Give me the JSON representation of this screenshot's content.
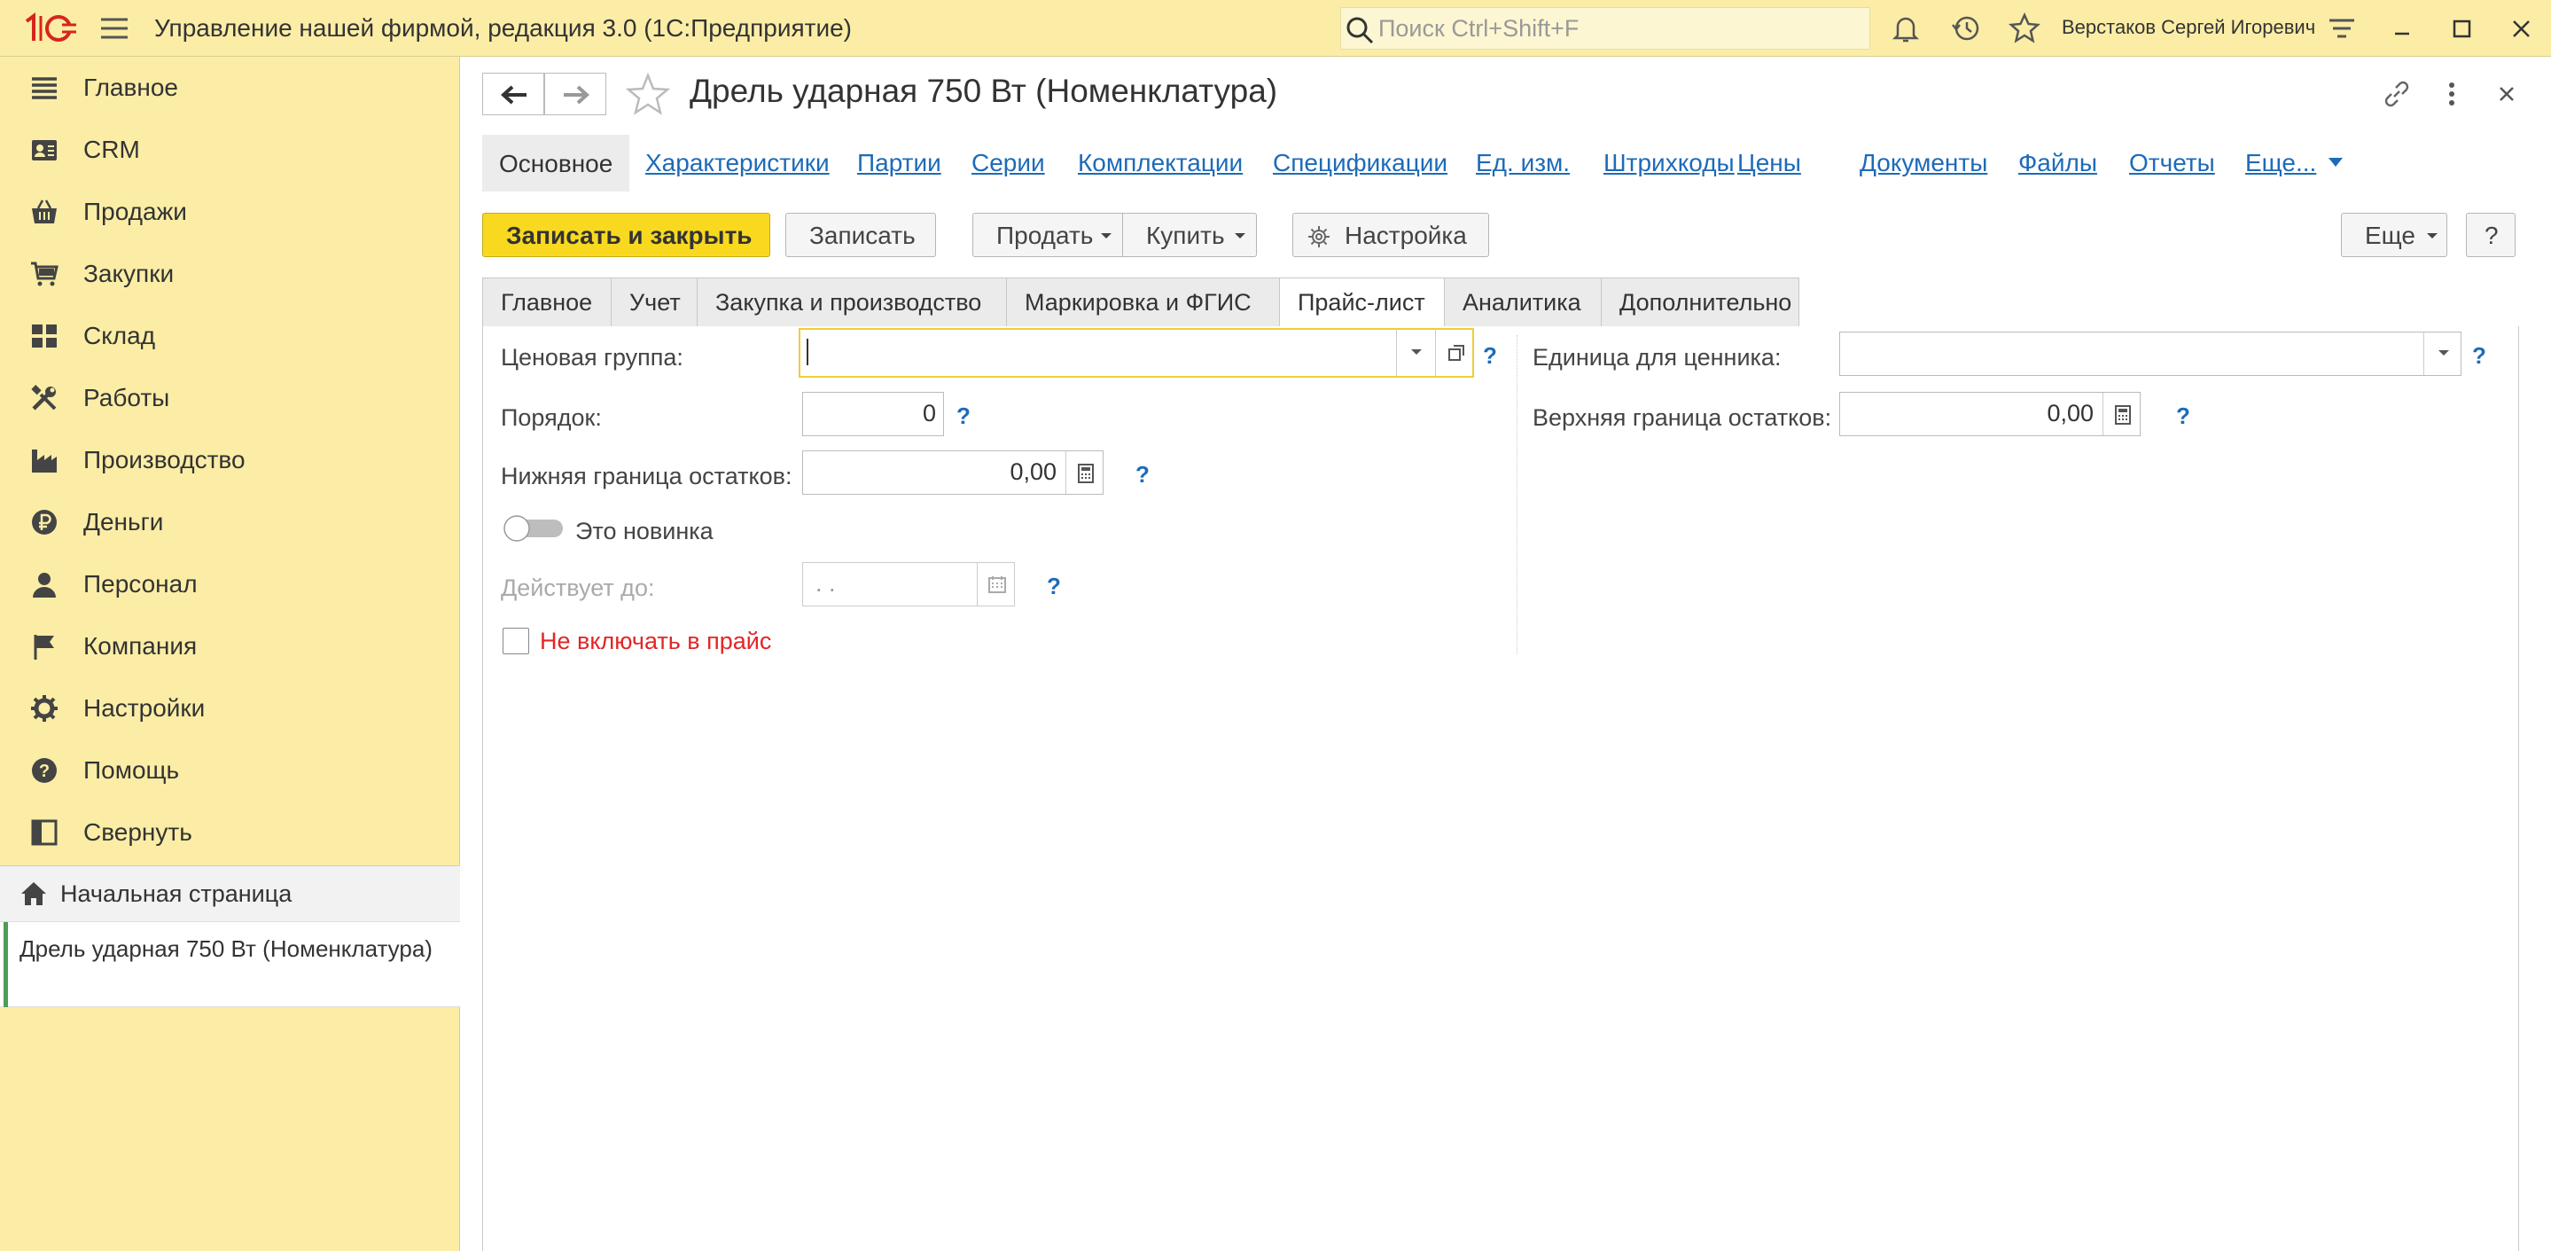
{
  "titlebar": {
    "app_title": "Управление нашей фирмой, редакция 3.0  (1С:Предприятие)",
    "search_placeholder": "Поиск Ctrl+Shift+F",
    "user": "Верстаков Сергей Игоревич",
    "icons": [
      "1c-logo-icon",
      "menu-icon",
      "search-icon",
      "bell-icon",
      "history-icon",
      "star-icon",
      "settings-icon",
      "minimize-icon",
      "maximize-icon",
      "close-icon"
    ]
  },
  "sidebar": {
    "items": [
      {
        "label": "Главное",
        "icon": "list-icon"
      },
      {
        "label": "CRM",
        "icon": "contact-card-icon"
      },
      {
        "label": "Продажи",
        "icon": "basket-icon"
      },
      {
        "label": "Закупки",
        "icon": "cart-icon"
      },
      {
        "label": "Склад",
        "icon": "grid-icon"
      },
      {
        "label": "Работы",
        "icon": "tools-icon"
      },
      {
        "label": "Производство",
        "icon": "factory-icon"
      },
      {
        "label": "Деньги",
        "icon": "ruble-coin-icon"
      },
      {
        "label": "Персонал",
        "icon": "person-icon"
      },
      {
        "label": "Компания",
        "icon": "flag-icon"
      },
      {
        "label": "Настройки",
        "icon": "gear-icon"
      },
      {
        "label": "Помощь",
        "icon": "help-icon"
      },
      {
        "label": "Свернуть",
        "icon": "collapse-icon"
      }
    ],
    "home": "Начальная страница",
    "open_doc": "Дрель ударная 750 Вт (Номенклатура)"
  },
  "form": {
    "title": "Дрель ударная 750 Вт (Номенклатура)",
    "nav_tabs": [
      "Основное",
      "Характеристики",
      "Партии",
      "Серии",
      "Комплектации",
      "Спецификации",
      "Ед. изм.",
      "Штрихкоды",
      "Цены",
      "Документы",
      "Файлы",
      "Отчеты",
      "Еще..."
    ],
    "buttons": {
      "save_close": "Записать и закрыть",
      "save": "Записать",
      "sell": "Продать",
      "buy": "Купить",
      "settings": "Настройка",
      "more": "Еще",
      "help": "?"
    },
    "tabs": [
      "Главное",
      "Учет",
      "Закупка и производство",
      "Маркировка и ФГИС",
      "Прайс-лист",
      "Аналитика",
      "Дополнительно"
    ],
    "active_tab": "Прайс-лист",
    "fields": {
      "price_group_label": "Ценовая группа:",
      "price_group_value": "",
      "order_label": "Порядок:",
      "order_value": "0",
      "lower_bound_label": "Нижняя граница остатков:",
      "lower_bound_value": "0,00",
      "new_toggle_label": "Это новинка",
      "new_toggle_on": false,
      "valid_until_label": "Действует до:",
      "valid_until_value": " .  .",
      "exclude_label": "Не включать в прайс",
      "exclude_checked": false,
      "unit_label": "Единица для ценника:",
      "unit_value": "",
      "upper_bound_label": "Верхняя граница остатков:",
      "upper_bound_value": "0,00",
      "help_mark": "?"
    }
  },
  "colors": {
    "sidebar_bg": "#fbeda6",
    "primary_button": "#f9d91f",
    "link": "#1d6bb8",
    "warning_text": "#e32626",
    "active_doc_bar": "#4b9d57"
  }
}
